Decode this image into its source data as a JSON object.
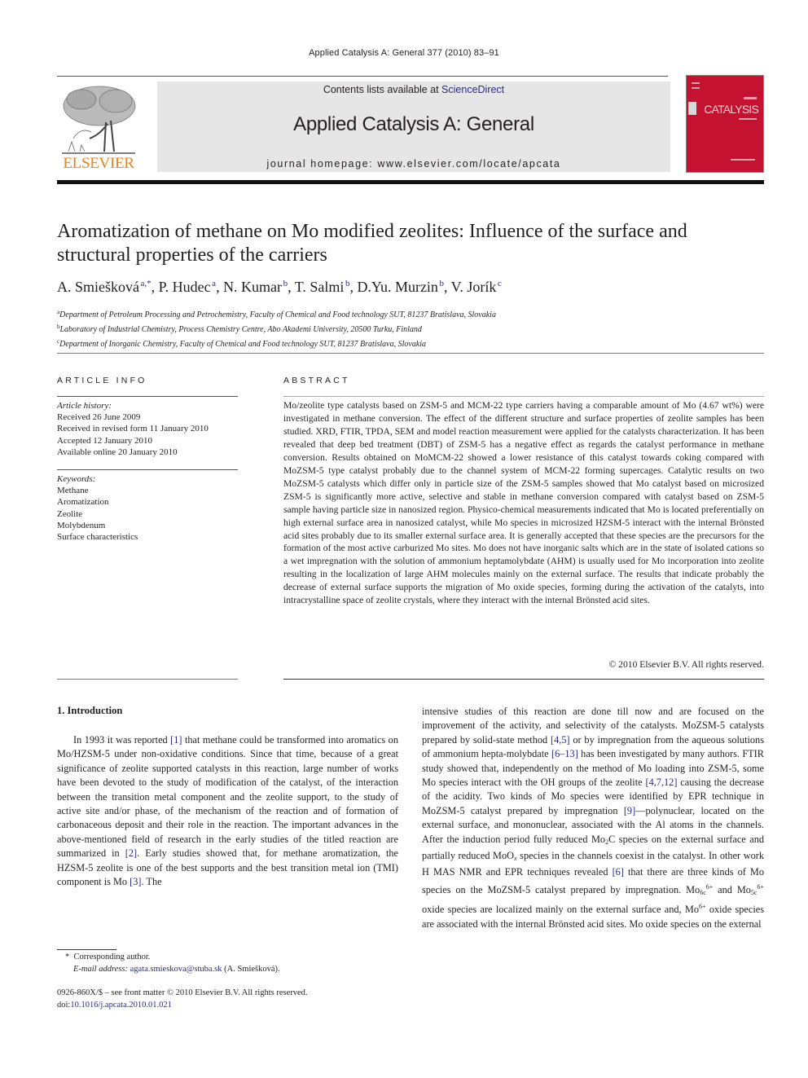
{
  "journal_ref": "Applied Catalysis A: General 377 (2010) 83–91",
  "masthead": {
    "contents_prefix": "Contents lists available at ",
    "contents_link": "ScienceDirect",
    "journal_name": "Applied Catalysis A: General",
    "homepage": "journal homepage: www.elsevier.com/locate/apcata"
  },
  "publisher": {
    "logo_text": "ELSEVIER",
    "logo_icon": "tree-icon",
    "logo_color": "#e8821c"
  },
  "cover": {
    "title": "CATALYSIS",
    "color": "#c41230"
  },
  "article": {
    "title": "Aromatization of methane on Mo modified zeolites: Influence of the surface and structural properties of the carriers",
    "authors": [
      {
        "name": "A. Smiešková",
        "sup": "a,*"
      },
      {
        "name": "P. Hudec",
        "sup": "a"
      },
      {
        "name": "N. Kumar",
        "sup": "b"
      },
      {
        "name": "T. Salmi",
        "sup": "b"
      },
      {
        "name": "D.Yu. Murzin",
        "sup": "b"
      },
      {
        "name": "V. Jorík",
        "sup": "c"
      }
    ],
    "affiliations": [
      {
        "mark": "a",
        "text": "Department of Petroleum Processing and Petrochemistry, Faculty of Chemical and Food technology SUT, 81237 Bratislava, Slovakia"
      },
      {
        "mark": "b",
        "text": "Laboratory of Industrial Chemistry, Process Chemistry Centre, Abo Akademi University, 20500 Turku, Finland"
      },
      {
        "mark": "c",
        "text": "Department of Inorganic Chemistry, Faculty of Chemical and Food technology SUT, 81237 Bratislava, Slovakia"
      }
    ]
  },
  "article_info": {
    "label": "ARTICLE INFO",
    "history_head": "Article history:",
    "history": [
      "Received 26 June 2009",
      "Received in revised form 11 January 2010",
      "Accepted 12 January 2010",
      "Available online 20 January 2010"
    ],
    "keywords_head": "Keywords:",
    "keywords": [
      "Methane",
      "Aromatization",
      "Zeolite",
      "Molybdenum",
      "Surface characteristics"
    ]
  },
  "abstract": {
    "label": "ABSTRACT",
    "text": "Mo/zeolite type catalysts based on ZSM-5 and MCM-22 type carriers having a comparable amount of Mo (4.67 wt%) were investigated in methane conversion. The effect of the different structure and surface properties of zeolite samples has been studied. XRD, FTIR, TPDA, SEM and model reaction measurement were applied for the catalysts characterization. It has been revealed that deep bed treatment (DBT) of ZSM-5 has a negative effect as regards the catalyst performance in methane conversion. Results obtained on MoMCM-22 showed a lower resistance of this catalyst towards coking compared with MoZSM-5 type catalyst probably due to the channel system of MCM-22 forming supercages. Catalytic results on two MoZSM-5 catalysts which differ only in particle size of the ZSM-5 samples showed that Mo catalyst based on microsized ZSM-5 is significantly more active, selective and stable in methane conversion compared with catalyst based on ZSM-5 sample having particle size in nanosized region. Physico-chemical measurements indicated that Mo is located preferentially on high external surface area in nanosized catalyst, while Mo species in microsized HZSM-5 interact with the internal Brönsted acid sites probably due to its smaller external surface area. It is generally accepted that these species are the precursors for the formation of the most active carburized Mo sites. Mo does not have inorganic salts which are in the state of isolated cations so a wet impregnation with the solution of ammonium heptamolybdate (AHM) is usually used for Mo incorporation into zeolite resulting in the localization of large AHM molecules mainly on the external surface. The results that indicate probably the decrease of external surface supports the migration of Mo oxide species, forming during the activation of the catalyts, into intracrystalline space of zeolite crystals, where they interact with the internal Brönsted acid sites.",
    "copyright": "© 2010 Elsevier B.V. All rights reserved."
  },
  "introduction": {
    "heading": "1.  Introduction",
    "left": {
      "t1": "In 1993 it was reported ",
      "r1": "[1]",
      "t2": " that methane could be transformed into aromatics on Mo/HZSM-5 under non-oxidative conditions. Since that time, because of a great significance of zeolite supported catalysts in this reaction, large number of works have been devoted to the study of modification of the catalyst, of the interaction between the transition metal component and the zeolite support, to the study of active site and/or phase, of the mechanism of the reaction and of formation of carbonaceous deposit and their role in the reaction. The important advances in the above-mentioned field of research in the early studies of the titled reaction are summarized in ",
      "r2": "[2]",
      "t3": ". Early studies showed that, for methane aromatization, the HZSM-5 zeolite is one of the best supports and the best transition metal ion (TMI) component is Mo ",
      "r3": "[3]",
      "t4": ". The"
    },
    "right": {
      "t1": "intensive studies of this reaction are done till now and are focused on the improvement of the activity, and selectivity of the catalysts. MoZSM-5 catalysts prepared by solid-state method ",
      "r1": "[4,5]",
      "t2": " or by impregnation from the aqueous solutions of ammonium hepta-molybdate ",
      "r2": "[6–13]",
      "t3": " has been investigated by many authors. FTIR study showed that, independently on the method of Mo loading into ZSM-5, some Mo species interact with the OH groups of the zeolite ",
      "r3": "[4,7,12]",
      "t4": " causing the decrease of the acidity. Two kinds of Mo species were identified by EPR technique in MoZSM-5 catalyst prepared by impregnation ",
      "r4": "[9]",
      "t5": "—polynuclear, located on the external surface, and mononuclear, associated with the Al atoms in the channels. After the induction period fully reduced Mo",
      "sub1": "2",
      "t6": "C species on the external surface and partially reduced MoO",
      "sub2": "x",
      "t7": " species in the channels coexist in the catalyst. In other work H MAS NMR and EPR techniques revealed ",
      "r5": "[6]",
      "t8": " that there are three kinds of Mo species on the MoZSM-5 catalyst prepared by impregnation. Mo",
      "sub3": "6c",
      "sup3": "6+",
      "t9": " and Mo",
      "sub4": "5c",
      "sup4": "6+",
      "t10": " oxide species are localized mainly on the external surface and, Mo",
      "sup5": "6+",
      "t11": " oxide species are associated with the internal Brönsted acid sites. Mo oxide species on the external"
    }
  },
  "footnote": {
    "mark": "*",
    "corresponding": "Corresponding author.",
    "email_label": "E-mail address:",
    "email": "agata.smieskova@stuba.sk",
    "email_suffix": " (A. Smiešková)."
  },
  "front_matter": {
    "issn_line": "0926-860X/$ – see front matter © 2010 Elsevier B.V. All rights reserved.",
    "doi_prefix": "doi:",
    "doi": "10.1016/j.apcata.2010.01.021"
  }
}
